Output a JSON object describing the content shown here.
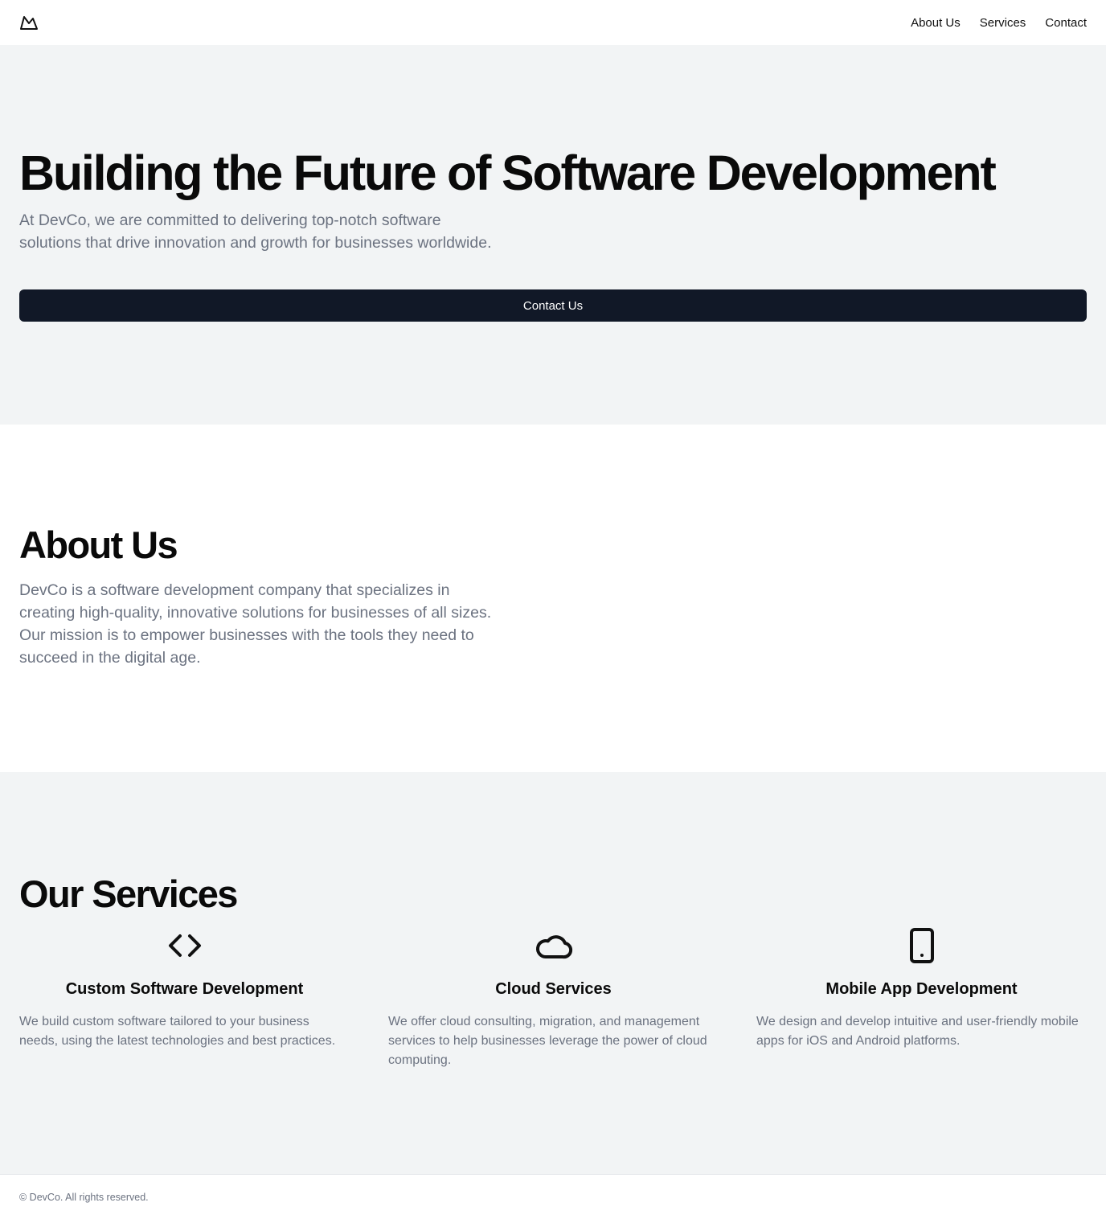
{
  "header": {
    "logo_icon": "mountain-icon",
    "nav": [
      {
        "label": "About Us"
      },
      {
        "label": "Services"
      },
      {
        "label": "Contact"
      }
    ]
  },
  "hero": {
    "title": "Building the Future of Software Development",
    "text": "At DevCo, we are committed to delivering top-notch software solutions that drive innovation and growth for businesses worldwide.",
    "button_label": "Contact Us"
  },
  "about": {
    "title": "About Us",
    "text": "DevCo is a software development company that specializes in creating high-quality, innovative solutions for businesses of all sizes. Our mission is to empower businesses with the tools they need to succeed in the digital age."
  },
  "services": {
    "title": "Our Services",
    "items": [
      {
        "icon": "code-icon",
        "title": "Custom Software Development",
        "text": "We build custom software tailored to your business needs, using the latest technologies and best practices."
      },
      {
        "icon": "cloud-icon",
        "title": "Cloud Services",
        "text": "We offer cloud consulting, migration, and management services to help businesses leverage the power of cloud computing."
      },
      {
        "icon": "smartphone-icon",
        "title": "Mobile App Development",
        "text": "We design and develop intuitive and user-friendly mobile apps for iOS and Android platforms."
      }
    ]
  },
  "footer": {
    "text": "© DevCo. All rights reserved."
  },
  "colors": {
    "primary_button": "#111827",
    "section_gray": "#f2f4f5",
    "muted_text": "#6b7280"
  }
}
